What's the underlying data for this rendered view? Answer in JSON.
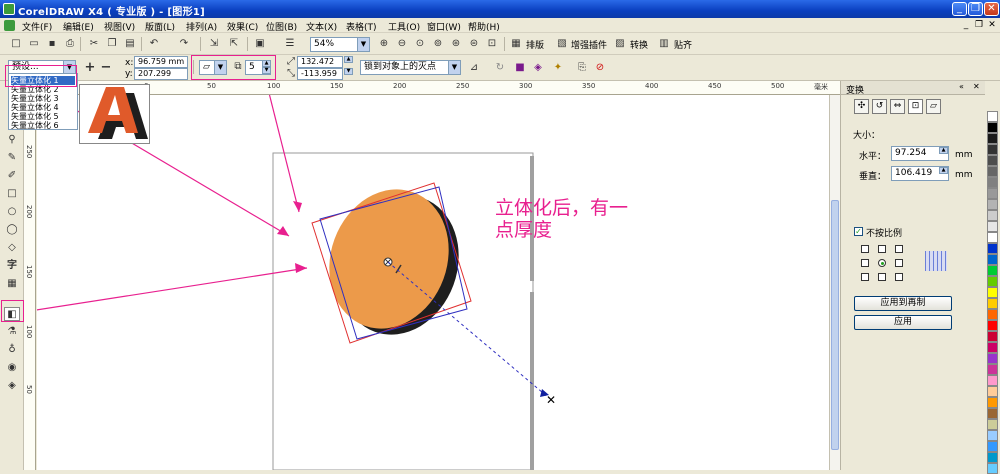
{
  "window": {
    "title": "CorelDRAW X4 ( 专业版 ) - [图形1]"
  },
  "menu": [
    "文件(F)",
    "编辑(E)",
    "视图(V)",
    "版面(L)",
    "排列(A)",
    "效果(C)",
    "位图(B)",
    "文本(X)",
    "表格(T)",
    "工具(O)",
    "窗口(W)",
    "帮助(H)"
  ],
  "toolbar": {
    "zoom": "54%",
    "arrange": "排版",
    "plugin": "增强插件",
    "convert": "转换",
    "align": "贴齐"
  },
  "propbar": {
    "preset": "预设...",
    "x_label": "x:",
    "x_value": "96.759 mm",
    "y_label": "y:",
    "y_value": "207.299 mm",
    "depth": "5",
    "vp_x": "132.472 mm",
    "vp_y": "-113.959 mm",
    "vp_lock": "锁到对象上的灭点"
  },
  "preset_list": [
    "矢量立体化 1",
    "矢量立体化 2",
    "矢量立体化 3",
    "矢量立体化 4",
    "矢量立体化 5",
    "矢量立体化 6"
  ],
  "ruler_h": [
    "50",
    "0",
    "50",
    "100",
    "150",
    "200",
    "250",
    "300",
    "350",
    "400",
    "450",
    "500",
    "550",
    "600",
    "毫米"
  ],
  "ruler_v": [
    "250",
    "200",
    "150",
    "100",
    "50",
    "0"
  ],
  "annotation": {
    "line1": "立体化后，有一",
    "line2": "点厚度"
  },
  "docker": {
    "title": "变换",
    "size_label": "大小：",
    "h_label": "水平：",
    "h_value": "97.254",
    "v_label": "垂直：",
    "v_value": "106.419",
    "unit": "mm",
    "proportional": "不按比例",
    "apply_dup": "应用到再制",
    "apply": "应用"
  },
  "palette": [
    "#ffffff",
    "#000000",
    "#1a1a1a",
    "#333333",
    "#4d4d4d",
    "#666666",
    "#808080",
    "#999999",
    "#b3b3b3",
    "#cccccc",
    "#e6e6e6",
    "#ffffff",
    "#0033cc",
    "#0066cc",
    "#00cc33",
    "#66cc00",
    "#ffff00",
    "#ffcc00",
    "#ff6600",
    "#ff0000",
    "#cc0033",
    "#cc0066",
    "#9933cc",
    "#cc3399",
    "#ff99cc",
    "#ffcc99",
    "#ff9900",
    "#996633",
    "#cccc99",
    "#99ccff",
    "#3399ff",
    "#0099cc",
    "#66ccff"
  ]
}
